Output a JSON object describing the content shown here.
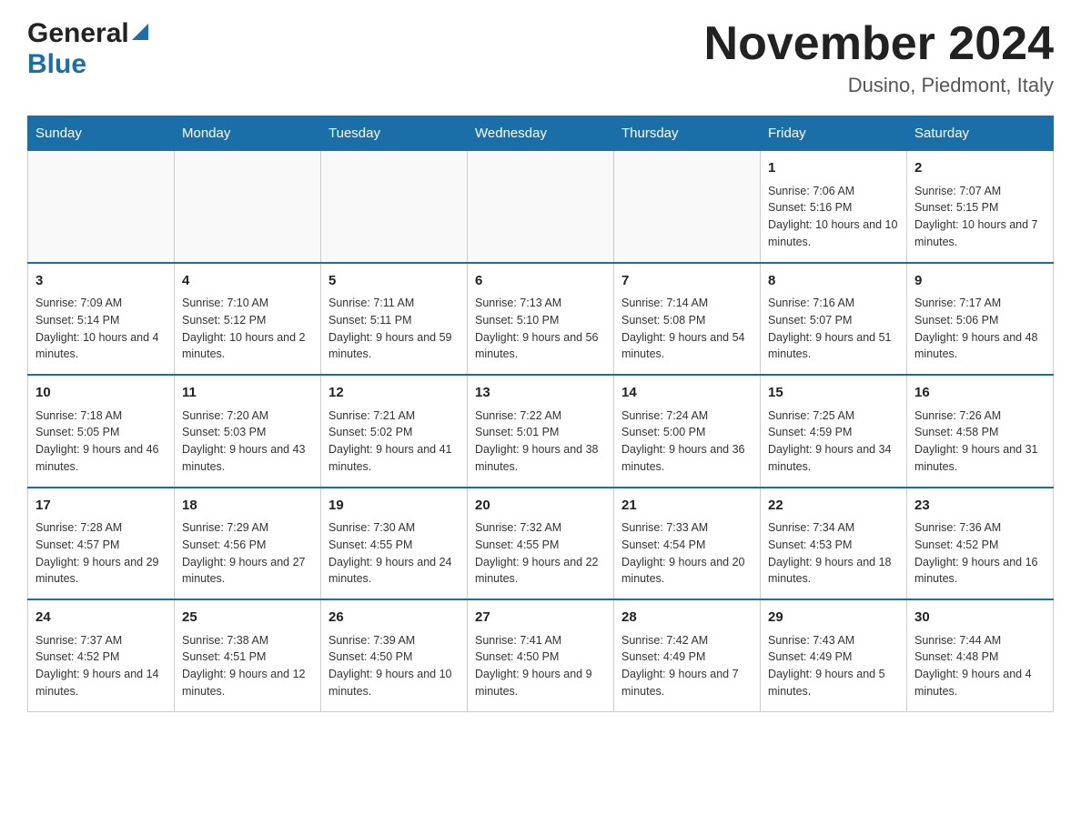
{
  "header": {
    "logo_general": "General",
    "logo_blue": "Blue",
    "month_title": "November 2024",
    "location": "Dusino, Piedmont, Italy"
  },
  "days_of_week": [
    "Sunday",
    "Monday",
    "Tuesday",
    "Wednesday",
    "Thursday",
    "Friday",
    "Saturday"
  ],
  "weeks": [
    [
      {
        "day": "",
        "info": ""
      },
      {
        "day": "",
        "info": ""
      },
      {
        "day": "",
        "info": ""
      },
      {
        "day": "",
        "info": ""
      },
      {
        "day": "",
        "info": ""
      },
      {
        "day": "1",
        "info": "Sunrise: 7:06 AM\nSunset: 5:16 PM\nDaylight: 10 hours and 10 minutes."
      },
      {
        "day": "2",
        "info": "Sunrise: 7:07 AM\nSunset: 5:15 PM\nDaylight: 10 hours and 7 minutes."
      }
    ],
    [
      {
        "day": "3",
        "info": "Sunrise: 7:09 AM\nSunset: 5:14 PM\nDaylight: 10 hours and 4 minutes."
      },
      {
        "day": "4",
        "info": "Sunrise: 7:10 AM\nSunset: 5:12 PM\nDaylight: 10 hours and 2 minutes."
      },
      {
        "day": "5",
        "info": "Sunrise: 7:11 AM\nSunset: 5:11 PM\nDaylight: 9 hours and 59 minutes."
      },
      {
        "day": "6",
        "info": "Sunrise: 7:13 AM\nSunset: 5:10 PM\nDaylight: 9 hours and 56 minutes."
      },
      {
        "day": "7",
        "info": "Sunrise: 7:14 AM\nSunset: 5:08 PM\nDaylight: 9 hours and 54 minutes."
      },
      {
        "day": "8",
        "info": "Sunrise: 7:16 AM\nSunset: 5:07 PM\nDaylight: 9 hours and 51 minutes."
      },
      {
        "day": "9",
        "info": "Sunrise: 7:17 AM\nSunset: 5:06 PM\nDaylight: 9 hours and 48 minutes."
      }
    ],
    [
      {
        "day": "10",
        "info": "Sunrise: 7:18 AM\nSunset: 5:05 PM\nDaylight: 9 hours and 46 minutes."
      },
      {
        "day": "11",
        "info": "Sunrise: 7:20 AM\nSunset: 5:03 PM\nDaylight: 9 hours and 43 minutes."
      },
      {
        "day": "12",
        "info": "Sunrise: 7:21 AM\nSunset: 5:02 PM\nDaylight: 9 hours and 41 minutes."
      },
      {
        "day": "13",
        "info": "Sunrise: 7:22 AM\nSunset: 5:01 PM\nDaylight: 9 hours and 38 minutes."
      },
      {
        "day": "14",
        "info": "Sunrise: 7:24 AM\nSunset: 5:00 PM\nDaylight: 9 hours and 36 minutes."
      },
      {
        "day": "15",
        "info": "Sunrise: 7:25 AM\nSunset: 4:59 PM\nDaylight: 9 hours and 34 minutes."
      },
      {
        "day": "16",
        "info": "Sunrise: 7:26 AM\nSunset: 4:58 PM\nDaylight: 9 hours and 31 minutes."
      }
    ],
    [
      {
        "day": "17",
        "info": "Sunrise: 7:28 AM\nSunset: 4:57 PM\nDaylight: 9 hours and 29 minutes."
      },
      {
        "day": "18",
        "info": "Sunrise: 7:29 AM\nSunset: 4:56 PM\nDaylight: 9 hours and 27 minutes."
      },
      {
        "day": "19",
        "info": "Sunrise: 7:30 AM\nSunset: 4:55 PM\nDaylight: 9 hours and 24 minutes."
      },
      {
        "day": "20",
        "info": "Sunrise: 7:32 AM\nSunset: 4:55 PM\nDaylight: 9 hours and 22 minutes."
      },
      {
        "day": "21",
        "info": "Sunrise: 7:33 AM\nSunset: 4:54 PM\nDaylight: 9 hours and 20 minutes."
      },
      {
        "day": "22",
        "info": "Sunrise: 7:34 AM\nSunset: 4:53 PM\nDaylight: 9 hours and 18 minutes."
      },
      {
        "day": "23",
        "info": "Sunrise: 7:36 AM\nSunset: 4:52 PM\nDaylight: 9 hours and 16 minutes."
      }
    ],
    [
      {
        "day": "24",
        "info": "Sunrise: 7:37 AM\nSunset: 4:52 PM\nDaylight: 9 hours and 14 minutes."
      },
      {
        "day": "25",
        "info": "Sunrise: 7:38 AM\nSunset: 4:51 PM\nDaylight: 9 hours and 12 minutes."
      },
      {
        "day": "26",
        "info": "Sunrise: 7:39 AM\nSunset: 4:50 PM\nDaylight: 9 hours and 10 minutes."
      },
      {
        "day": "27",
        "info": "Sunrise: 7:41 AM\nSunset: 4:50 PM\nDaylight: 9 hours and 9 minutes."
      },
      {
        "day": "28",
        "info": "Sunrise: 7:42 AM\nSunset: 4:49 PM\nDaylight: 9 hours and 7 minutes."
      },
      {
        "day": "29",
        "info": "Sunrise: 7:43 AM\nSunset: 4:49 PM\nDaylight: 9 hours and 5 minutes."
      },
      {
        "day": "30",
        "info": "Sunrise: 7:44 AM\nSunset: 4:48 PM\nDaylight: 9 hours and 4 minutes."
      }
    ]
  ]
}
